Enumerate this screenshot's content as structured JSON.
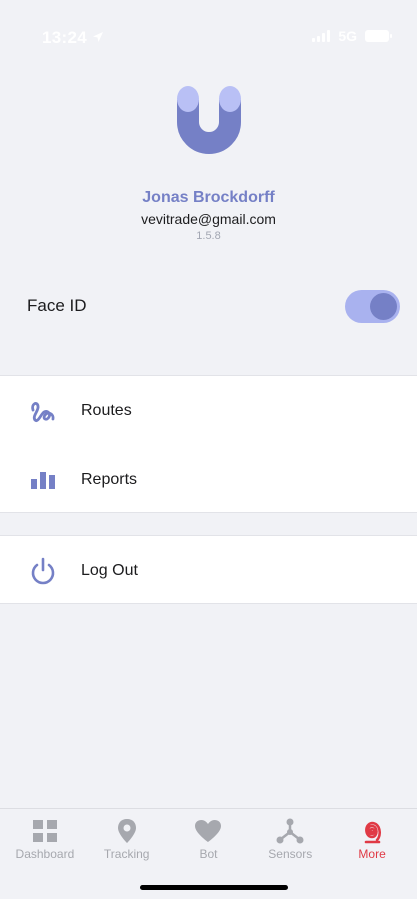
{
  "status_bar": {
    "time": "13:24",
    "network": "5G"
  },
  "profile": {
    "name": "Jonas Brockdorff",
    "email": "vevitrade@gmail.com",
    "version": "1.5.8"
  },
  "settings": {
    "face_id_label": "Face ID",
    "face_id_enabled": true
  },
  "menu": {
    "group1": [
      {
        "label": "Routes",
        "icon": "route-squiggle-icon"
      },
      {
        "label": "Reports",
        "icon": "bar-chart-icon"
      }
    ],
    "group2": [
      {
        "label": "Log Out",
        "icon": "power-icon"
      }
    ]
  },
  "tab_bar": {
    "tabs": [
      {
        "label": "Dashboard",
        "icon": "dashboard-grid-icon",
        "active": false
      },
      {
        "label": "Tracking",
        "icon": "location-pin-icon",
        "active": false
      },
      {
        "label": "Bot",
        "icon": "heart-icon",
        "active": false
      },
      {
        "label": "Sensors",
        "icon": "sensors-network-icon",
        "active": false
      },
      {
        "label": "More",
        "icon": "spiral-icon",
        "active": true
      }
    ]
  },
  "colors": {
    "accent": "#7580c6",
    "toggle_track": "#a9b2ef",
    "active_tab": "#e03a45",
    "inactive_tab": "#a6a8ae",
    "background": "#f1f2f6"
  }
}
